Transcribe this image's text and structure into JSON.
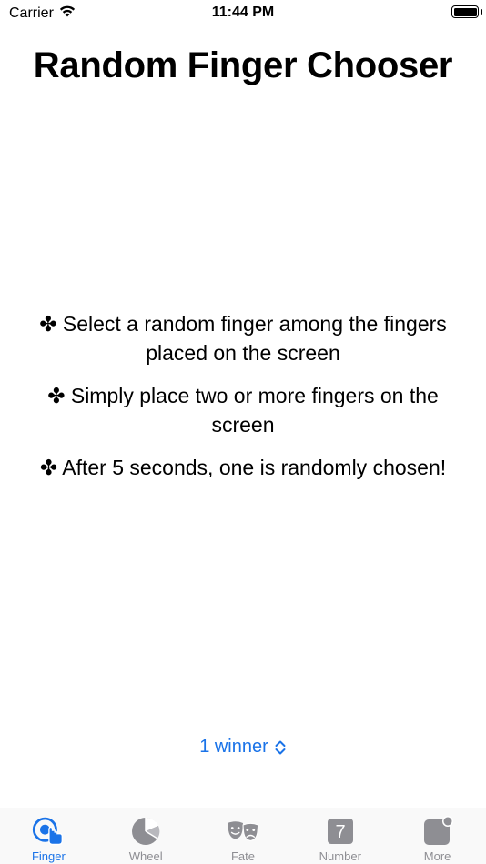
{
  "status_bar": {
    "carrier": "Carrier",
    "time": "11:44 PM"
  },
  "title": "Random Finger Chooser",
  "instructions": [
    "✤ Select a random finger among the fingers placed on the screen",
    "✤ Simply place two or more fingers on the screen",
    "✤ After 5 seconds, one is randomly chosen!"
  ],
  "winner_selector": {
    "label": "1 winner"
  },
  "tabs": [
    {
      "label": "Finger",
      "icon": "finger-tap-icon",
      "active": true
    },
    {
      "label": "Wheel",
      "icon": "pie-chart-icon",
      "active": false
    },
    {
      "label": "Fate",
      "icon": "theater-masks-icon",
      "active": false
    },
    {
      "label": "Number",
      "icon": "number-seven-icon",
      "number": "7",
      "active": false
    },
    {
      "label": "More",
      "icon": "more-app-badge-icon",
      "active": false
    }
  ],
  "colors": {
    "accent": "#1a73e8",
    "inactive": "#8e8e93",
    "tab_bar_bg": "#f9f9f9"
  }
}
